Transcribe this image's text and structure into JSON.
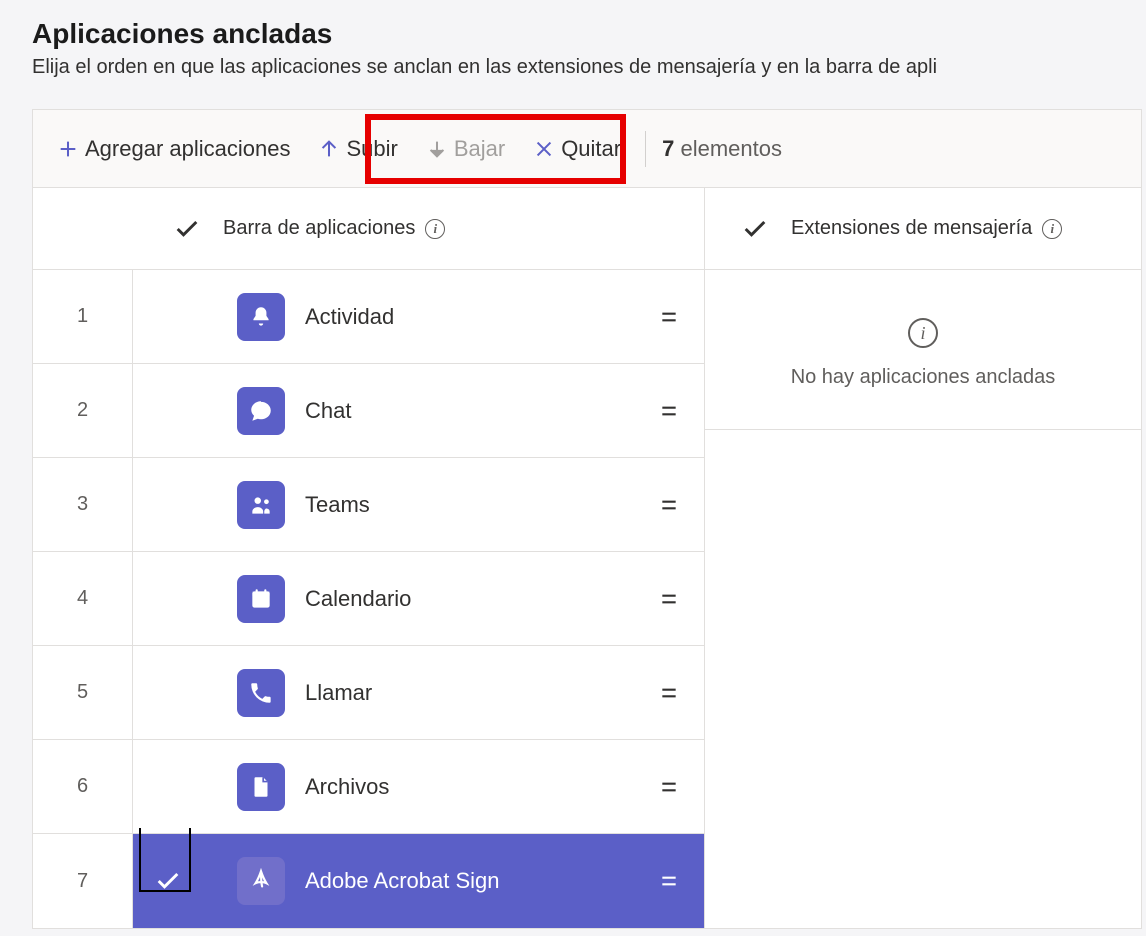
{
  "header": {
    "title": "Aplicaciones ancladas",
    "subtitle": "Elija el orden en que las aplicaciones se anclan en las extensiones de mensajería y en la barra de apli"
  },
  "toolbar": {
    "add_label": "Agregar aplicaciones",
    "up_label": "Subir",
    "down_label": "Bajar",
    "remove_label": "Quitar",
    "count_number": "7",
    "count_label": "elementos"
  },
  "columns": {
    "left_label": "Barra de aplicaciones",
    "right_label": "Extensiones de mensajería"
  },
  "apps": [
    {
      "index": "1",
      "name": "Actividad",
      "icon": "bell",
      "selected": false
    },
    {
      "index": "2",
      "name": "Chat",
      "icon": "chat",
      "selected": false
    },
    {
      "index": "3",
      "name": "Teams",
      "icon": "teams",
      "selected": false
    },
    {
      "index": "4",
      "name": "Calendario",
      "icon": "calendar",
      "selected": false
    },
    {
      "index": "5",
      "name": "Llamar",
      "icon": "phone",
      "selected": false
    },
    {
      "index": "6",
      "name": "Archivos",
      "icon": "file",
      "selected": false
    },
    {
      "index": "7",
      "name": "Adobe Acrobat Sign",
      "icon": "acrobat",
      "selected": true
    }
  ],
  "empty_state": {
    "text": "No hay aplicaciones ancladas"
  }
}
